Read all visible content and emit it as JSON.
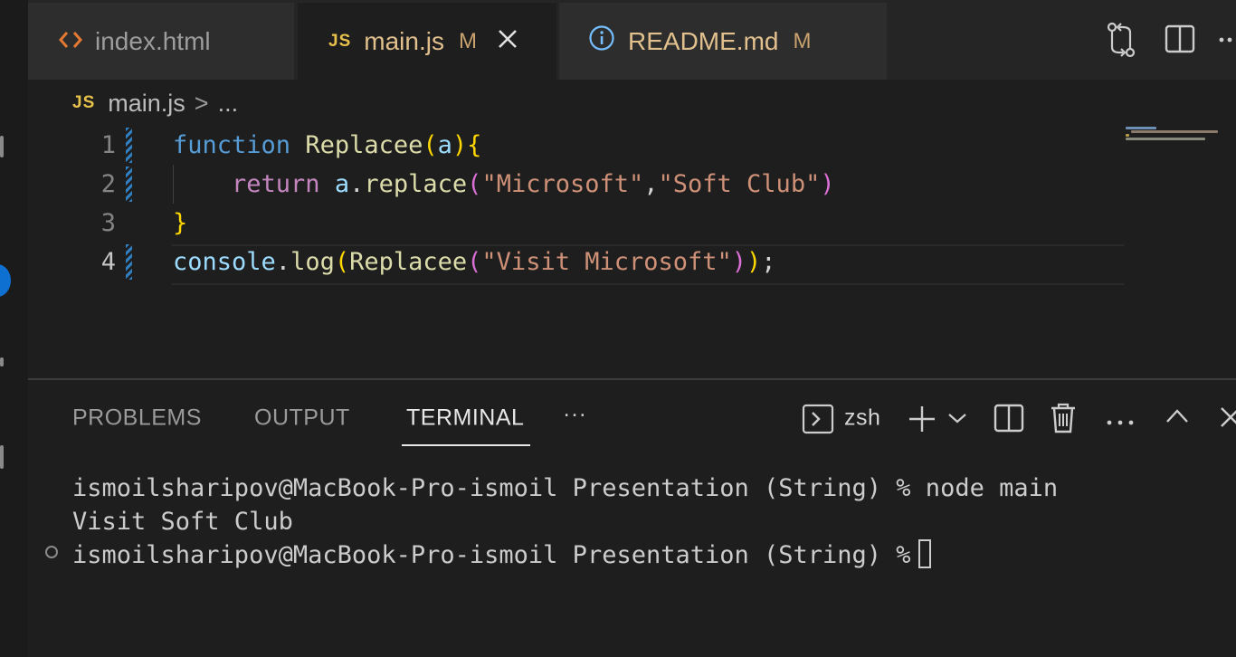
{
  "tabs": [
    {
      "label": "index.html",
      "icon": "html-code-icon",
      "modified": "",
      "active": false
    },
    {
      "label": "main.js",
      "icon": "JS",
      "modified": "M",
      "active": true
    },
    {
      "label": "README.md",
      "icon": "info-icon",
      "modified": "M",
      "active": false
    }
  ],
  "breadcrumb": {
    "icon": "JS",
    "file": "main.js",
    "separator": ">",
    "more": "..."
  },
  "editor": {
    "line_numbers": [
      "1",
      "2",
      "3",
      "4"
    ],
    "lines": [
      {
        "t1": "function",
        "t2": " ",
        "t3": "Replacee",
        "t4": "(",
        "t5": "a",
        "t6": ")",
        "t7": "{"
      },
      {
        "t1": "    ",
        "t2": "return",
        "t3": " ",
        "t4": "a",
        "t5": ".",
        "t6": "replace",
        "t7": "(",
        "t8": "\"Microsoft\"",
        "t9": ",",
        "t10": "\"Soft Club\"",
        "t11": ")"
      },
      {
        "t1": "}"
      },
      {
        "t1": "console",
        "t2": ".",
        "t3": "log",
        "t4": "(",
        "t5": "Replacee",
        "t6": "(",
        "t7": "\"Visit Microsoft\"",
        "t8": ")",
        "t9": ")",
        "t10": ";"
      }
    ]
  },
  "panel": {
    "tabs": [
      "PROBLEMS",
      "OUTPUT",
      "TERMINAL"
    ],
    "more": "···",
    "shell": "zsh"
  },
  "terminal": {
    "lines": [
      "ismoilsharipov@MacBook-Pro-ismoil Presentation (String) % node main",
      "Visit Soft Club",
      "ismoilsharipov@MacBook-Pro-ismoil Presentation (String) %"
    ]
  },
  "colors": {
    "accent": "#0e70d1",
    "js_badge": "#e8c14b",
    "modified": "#e2c08d"
  }
}
